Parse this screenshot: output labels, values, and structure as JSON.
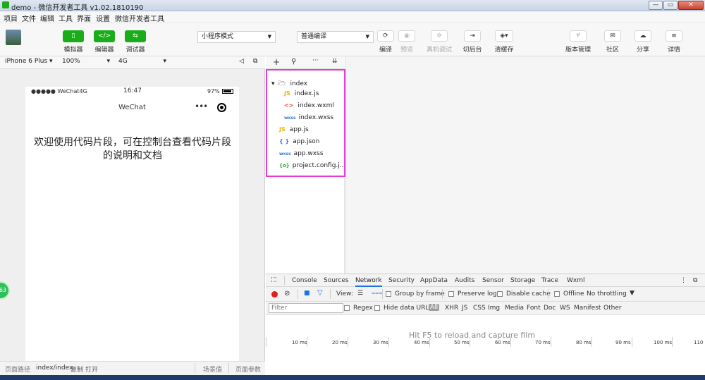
{
  "window": {
    "title": "demo - 微信开发者工具 v1.02.1810190",
    "buttons": {
      "minimize": "—",
      "maximize": "▭",
      "close": "✕"
    }
  },
  "menu": [
    "项目",
    "文件",
    "编辑",
    "工具",
    "界面",
    "设置",
    "微信开发者工具"
  ],
  "toolbar": {
    "simulator_label": "模拟器",
    "editor_label": "编辑器",
    "debugger_label": "调试器",
    "mode_select": "小程序模式",
    "compile_select": "普通编译",
    "compile_label": "编译",
    "preview_label": "预览",
    "remote_debug_label": "真机调试",
    "background_label": "切后台",
    "clear_cache_label": "清缓存",
    "version_label": "版本管理",
    "community_label": "社区",
    "share_label": "分享",
    "details_label": "详情"
  },
  "device_bar": {
    "device": "iPhone 6 Plus",
    "zoom": "100%",
    "network": "4G"
  },
  "phone": {
    "carrier": "●●●●● WeChat4G",
    "time": "16:47",
    "battery": "97%",
    "nav_title": "WeChat",
    "content": "欢迎使用代码片段，可在控制台查看代码片段的说明和文档"
  },
  "bottom_bar": {
    "path_label": "页面路径",
    "path_value": "index/index",
    "copy": "复制",
    "open": "打开",
    "scene": "场景值",
    "params": "页面参数"
  },
  "file_tree": {
    "folder": "index",
    "children": [
      {
        "icon": "JS",
        "name": "index.js",
        "color": "#e8b800"
      },
      {
        "icon": "<>",
        "name": "index.wxml",
        "color": "#e44d26"
      },
      {
        "icon": "wxss",
        "name": "index.wxss",
        "color": "#2b7bd6"
      }
    ],
    "root_files": [
      {
        "icon": "JS",
        "name": "app.js",
        "color": "#e8b800"
      },
      {
        "icon": "{ }",
        "name": "app.json",
        "color": "#2b7bd6"
      },
      {
        "icon": "wxss",
        "name": "app.wxss",
        "color": "#2b7bd6"
      },
      {
        "icon": "{o}",
        "name": "project.config.j...",
        "color": "#1aad19"
      }
    ]
  },
  "devtools": {
    "tabs": [
      "Console",
      "Sources",
      "Network",
      "Security",
      "AppData",
      "Audits",
      "Sensor",
      "Storage",
      "Trace",
      "Wxml"
    ],
    "active_tab": "Network",
    "view_label": "View:",
    "group_by_frame": "Group by frame",
    "preserve_log": "Preserve log",
    "disable_cache": "Disable cache",
    "offline": "Offline",
    "throttling": "No throttling",
    "filter_placeholder": "Filter",
    "regex": "Regex",
    "hide_data_urls": "Hide data URLs",
    "types": [
      "All",
      "XHR",
      "JS",
      "CSS",
      "Img",
      "Media",
      "Font",
      "Doc",
      "WS",
      "Manifest",
      "Other"
    ],
    "hint": "Hit F5 to reload and capture film",
    "ticks": [
      "10 ms",
      "20 ms",
      "30 ms",
      "40 ms",
      "50 ms",
      "60 ms",
      "70 ms",
      "80 ms",
      "90 ms",
      "100 ms",
      "110"
    ]
  },
  "badge": "63"
}
